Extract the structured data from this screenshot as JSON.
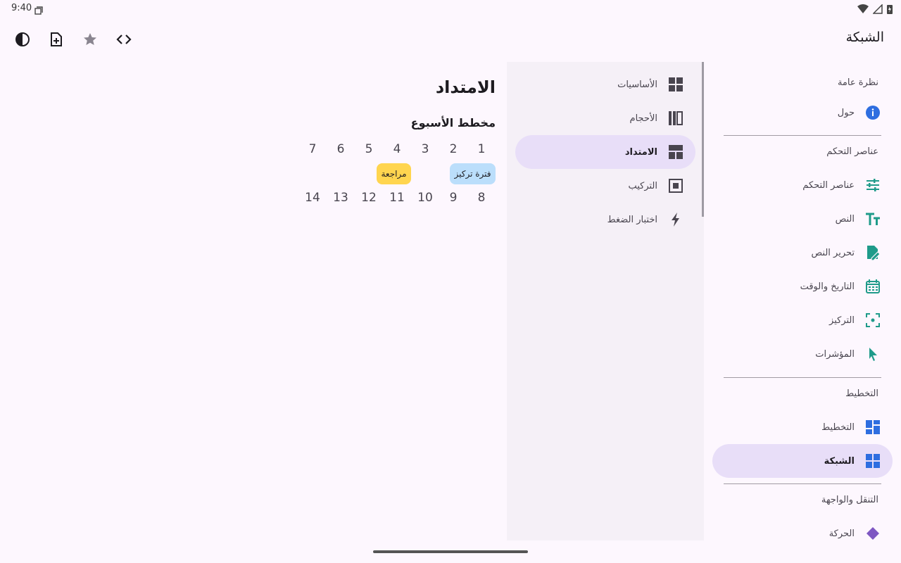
{
  "status": {
    "time": "9:40"
  },
  "app_title": "الشبكة",
  "toolbar_icons": [
    "theme-contrast-icon",
    "new-document-icon",
    "star-icon",
    "code-icon"
  ],
  "nav": {
    "overview_header": "نظرة عامة",
    "about": "حول",
    "controls_header": "عناصر التحكم",
    "controls": "عناصر التحكم",
    "text": "النص",
    "text_edit": "تحرير النص",
    "datetime": "التاريخ والوقت",
    "focus": "التركيز",
    "pointers": "المؤشرات",
    "layout_header": "التخطيط",
    "layout": "التخطيط",
    "grid": "الشبكة",
    "nav_header": "التنقل والواجهة",
    "partial": "الحركة"
  },
  "panel": {
    "items": [
      "الأساسيات",
      "الأحجام",
      "الامتداد",
      "التركيب",
      "اختبار الضغط"
    ],
    "active_index": 2
  },
  "content": {
    "title": "الامتداد",
    "section_title": "مخطط الأسبوع",
    "week1": [
      "1",
      "2",
      "3",
      "4",
      "5",
      "6",
      "7"
    ],
    "week2": [
      "8",
      "9",
      "10",
      "11",
      "12",
      "13",
      "14"
    ],
    "events": [
      {
        "label": "فترة تركيز",
        "color": "#bbdefb"
      },
      {
        "label": "مراجعة",
        "color": "#ffd54f"
      }
    ]
  },
  "colors": {
    "accent": "#e8def8",
    "background": "#fdf7fe",
    "panel": "#f5f0f7"
  }
}
